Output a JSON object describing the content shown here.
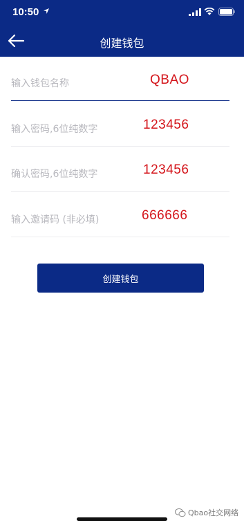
{
  "status_bar": {
    "time": "10:50"
  },
  "header": {
    "title": "创建钱包",
    "accent_color": "#0b2a86"
  },
  "form": {
    "wallet_name": {
      "placeholder": "输入钱包名称",
      "value": "QBAO"
    },
    "password": {
      "placeholder": "输入密码,6位纯数字",
      "value": "123456"
    },
    "confirm_password": {
      "placeholder": "确认密码,6位纯数字",
      "value": "123456"
    },
    "invite_code": {
      "placeholder": "输入邀请码 (非必填)",
      "value": "666666"
    }
  },
  "actions": {
    "create_label": "创建钱包"
  },
  "watermark": {
    "text": "Qbao社交网络",
    "icon": "wechat-icon"
  },
  "colors": {
    "annotation": "#d4151b",
    "placeholder": "#b8b8be"
  }
}
